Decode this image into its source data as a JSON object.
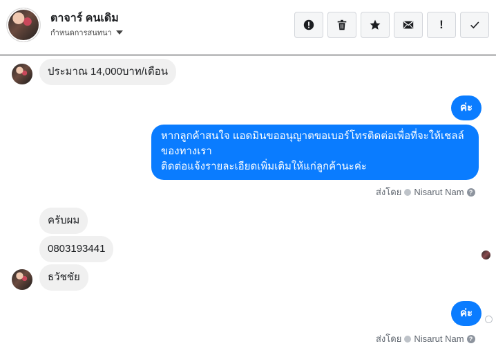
{
  "header": {
    "contact_name": "ตาจาร์ คนเดิม",
    "subtitle": "กำหนดการสนทนา",
    "actions": [
      {
        "icon": "alert-circle-icon",
        "label": ""
      },
      {
        "icon": "trash-icon",
        "label": ""
      },
      {
        "icon": "star-icon",
        "label": ""
      },
      {
        "icon": "envelope-icon",
        "label": ""
      },
      {
        "icon": "exclamation-icon",
        "label": "!"
      },
      {
        "icon": "check-icon",
        "label": ""
      }
    ]
  },
  "messages": {
    "m1": "ประมาณ 14,000บาท/เดือน",
    "m2": "ค่ะ",
    "m3": [
      "หากลูกค้าสนใจ แอดมินขออนุญาตขอเบอร์โทรติดต่อเพื่อที่จะให้เชลล์",
      "ของทางเรา",
      "ติดต่อแจ้งรายละเอียดเพิ่มเติมให้แก่ลูกค้านะค่ะ"
    ],
    "m4": "ครับผม",
    "m5": "0803193441",
    "m6": "ธวัชชัย",
    "m7": "ค่ะ"
  },
  "sent_by": {
    "label": "ส่งโดย",
    "agent": "Nisarut Nam",
    "help": "?"
  },
  "colors": {
    "outgoing_bubble": "#0a7cff",
    "incoming_bubble": "#f0f0f0"
  }
}
